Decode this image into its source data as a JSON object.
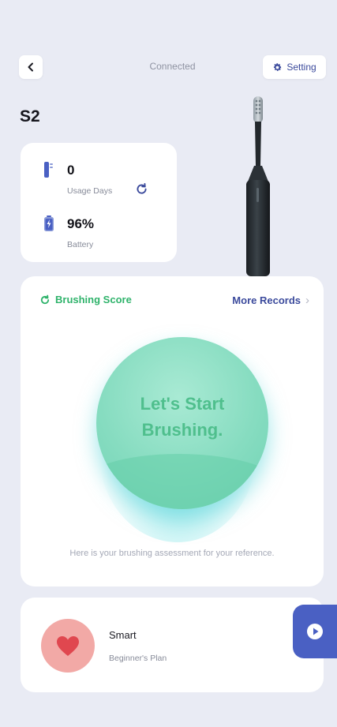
{
  "header": {
    "title": "Connected",
    "setting_label": "Setting"
  },
  "device": {
    "name": "S2"
  },
  "stats": {
    "usage_days_value": "0",
    "usage_days_label": "Usage Days",
    "battery_value": "96%",
    "battery_label": "Battery",
    "battery_level": 0.96
  },
  "score": {
    "title": "Brushing Score",
    "more_records_label": "More Records",
    "orb_line1": "Let's Start",
    "orb_line2": "Brushing.",
    "hint": "Here is your brushing assessment for your reference."
  },
  "plan": {
    "title": "Smart",
    "subtitle": "Beginner's Plan"
  },
  "colors": {
    "background": "#e9ebf4",
    "accent_blue": "#3b4a9c",
    "accent_green": "#2fb36b",
    "heart_bg": "#f2a9a6",
    "heart": "#e0474f",
    "float_button": "#4a60c3"
  },
  "icons": {
    "back": "chevron-left-icon",
    "setting": "gear-icon",
    "usage": "toothbrush-head-icon",
    "battery": "battery-icon",
    "sync": "refresh-icon",
    "score": "refresh-icon",
    "more": "chevron-right-icon",
    "plan": "heart-icon",
    "float": "play-icon"
  }
}
